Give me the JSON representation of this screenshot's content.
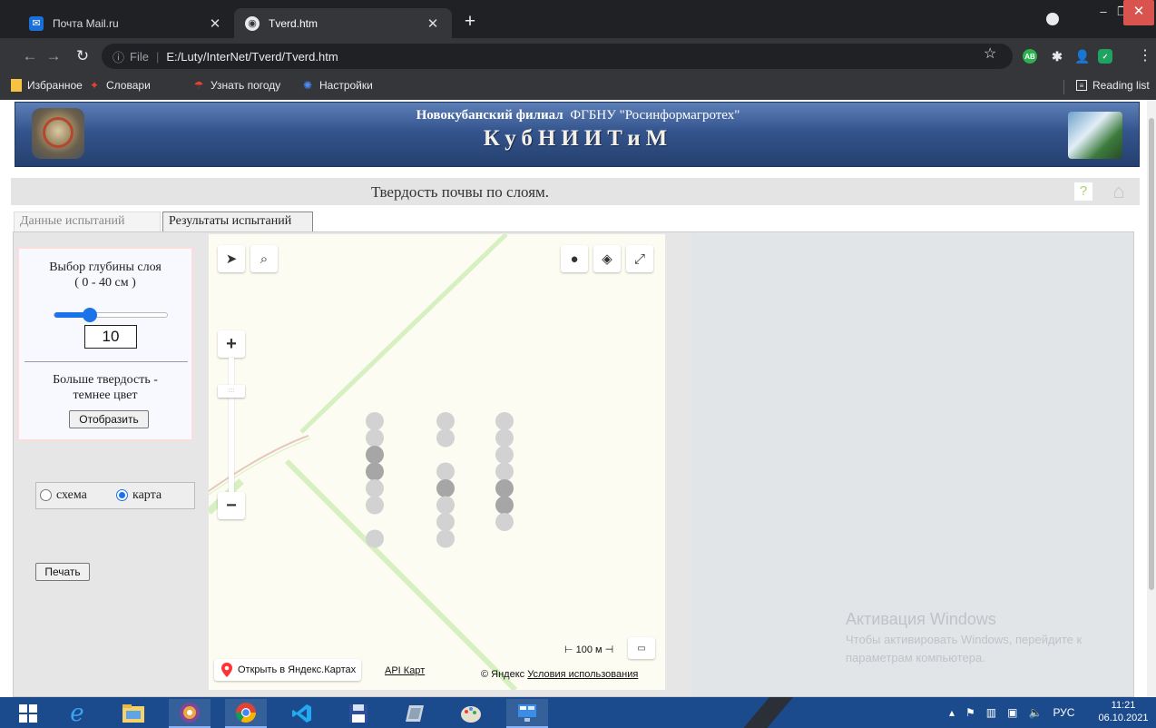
{
  "browser": {
    "tabs": [
      {
        "title": "Почта Mail.ru",
        "active": false,
        "favicon": "mail-icon"
      },
      {
        "title": "Tverd.htm",
        "active": true,
        "favicon": "globe-icon"
      }
    ],
    "address": {
      "scheme": "File",
      "url": "E:/Luty/InterNet/Tverd/Tverd.htm"
    },
    "bookmarks": [
      {
        "label": "Избранное",
        "icon": "folder-icon"
      },
      {
        "label": "Словари",
        "icon": "dictionary-icon"
      },
      {
        "label": "Узнать погоду",
        "icon": "umbrella-icon"
      },
      {
        "label": "Настройки",
        "icon": "gear-icon"
      }
    ],
    "reading_list": "Reading list",
    "extensions": {
      "ab_badge": "AB"
    }
  },
  "header": {
    "subtitle_bold": "Новокубанский филиал",
    "subtitle_org": "ФГБНУ \"Росинформагротех\"",
    "title": "КубНИИТиМ"
  },
  "page": {
    "title": "Твердость почвы по слоям.",
    "help": "?",
    "tabs": [
      {
        "label": "Данные испытаний",
        "active": false
      },
      {
        "label": "Результаты испытаний",
        "active": true
      }
    ]
  },
  "controls": {
    "depth_label_line1": "Выбор глубины слоя",
    "depth_label_line2": "( 0 - 40 см )",
    "slider_min": 0,
    "slider_max": 40,
    "depth_value": "10",
    "hint_line1": "Больше твердость -",
    "hint_line2": "темнее цвет",
    "show_button": "Отобразить",
    "view_options": {
      "scheme": "схема",
      "map": "карта",
      "selected": "map"
    },
    "print_button": "Печать"
  },
  "map": {
    "scale_label": "100 м",
    "open_in_yandex": "Открыть в Яндекс.Картах",
    "api_link": "API Карт",
    "copyright": "© Яндекс",
    "terms": "Условия использования",
    "colors": {
      "road": "#d6f0c2",
      "light_point": "#d2d2d2",
      "dark_point": "#a6a6a6",
      "background": "#fdfcf2"
    },
    "point_columns": [
      [
        "light",
        "light",
        "dark",
        "dark",
        "light",
        "light",
        "empty",
        "light"
      ],
      [
        "light",
        "light",
        "empty",
        "light",
        "dark",
        "light",
        "light",
        "light"
      ],
      [
        "light",
        "light",
        "light",
        "light",
        "dark",
        "dark",
        "light"
      ]
    ]
  },
  "activation": {
    "head": "Активация Windows",
    "line1": "Чтобы активировать Windows, перейдите к",
    "line2": "параметрам компьютера."
  },
  "taskbar": {
    "language": "РУС",
    "time": "11:21",
    "date": "06.10.2021"
  }
}
